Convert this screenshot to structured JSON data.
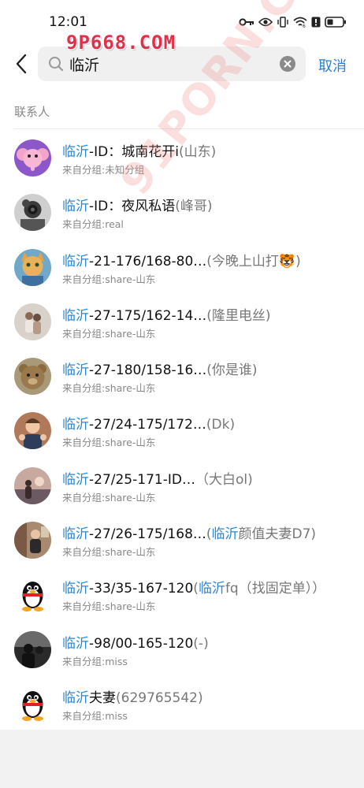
{
  "status_bar": {
    "time": "12:01"
  },
  "watermark": {
    "top": "9P668.COM",
    "diagonal": "91PORN.COM"
  },
  "search": {
    "query": "临沂",
    "cancel_label": "取消"
  },
  "section": {
    "title": "联系人"
  },
  "contacts": [
    {
      "hl": "临沂",
      "name": "-ID：城南花开i",
      "tail": "(山东)",
      "group": "来自分组:未知分组",
      "avatar": "pink-elephant"
    },
    {
      "hl": "临沂",
      "name": "-ID：夜风私语",
      "tail": "(峰哥)",
      "group": "来自分组:real",
      "avatar": "camera-photo"
    },
    {
      "hl": "临沂",
      "name": "-21-176/168-80…",
      "tail": "(今晚上山打🐯)",
      "group": "来自分组:share-山东",
      "avatar": "painted-cat"
    },
    {
      "hl": "临沂",
      "name": "-27-175/162-14…",
      "tail": "(隆里电丝)",
      "group": "来自分组:share-山东",
      "avatar": "couple-photo"
    },
    {
      "hl": "临沂",
      "name": "-27-180/158-16…",
      "tail": "(你是谁)",
      "group": "来自分组:share-山东",
      "avatar": "teddy-bear"
    },
    {
      "hl": "临沂",
      "name": "-27/24-175/172…",
      "tail": "(Dk)",
      "group": "来自分组:share-山东",
      "avatar": "child-photo"
    },
    {
      "hl": "临沂",
      "name": "-27/25-171-ID…",
      "tail": "（大白ol)",
      "group": "来自分组:share-山东",
      "avatar": "sunset-photo"
    },
    {
      "hl": "临沂",
      "name": "-27/26-175/168…",
      "tail": "(",
      "hl2": "临沂",
      "tail2": "颜值夫妻D7)",
      "group": "来自分组:share-山东",
      "avatar": "room-photo"
    },
    {
      "hl": "临沂",
      "name": "-33/35-167-120",
      "tail": "(",
      "hl2": "临沂",
      "tail2": "fq（找固定单））",
      "group": "来自分组:share-山东",
      "avatar": "qq-penguin"
    },
    {
      "hl": "临沂",
      "name": "-98/00-165-120",
      "tail": "(-)",
      "group": "来自分组:miss",
      "avatar": "dark-photo"
    },
    {
      "hl": "临沂",
      "name": "夫妻",
      "tail": "(629765542)",
      "group": "来自分组:miss",
      "avatar": "qq-penguin"
    }
  ],
  "colors": {
    "accent": "#2a86d4",
    "cancel": "#2a7fd8",
    "watermark": "#e0304a"
  }
}
